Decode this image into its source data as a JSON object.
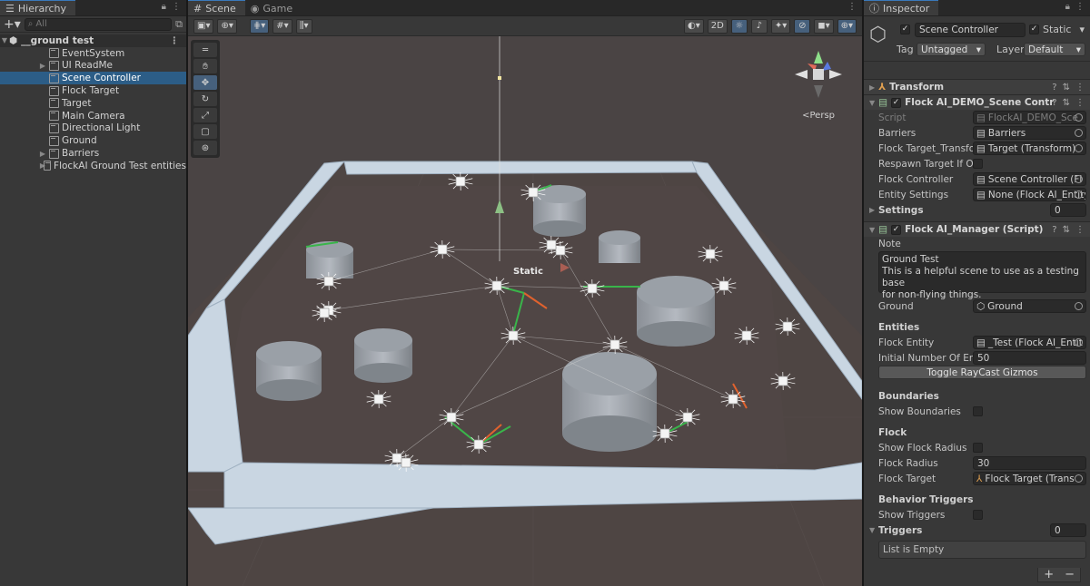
{
  "hierarchy": {
    "tab": "Hierarchy",
    "search_placeholder": "All",
    "scene": "__ground test",
    "items": [
      {
        "label": "EventSystem",
        "arrow": false,
        "selected": false
      },
      {
        "label": "UI ReadMe",
        "arrow": true,
        "selected": false
      },
      {
        "label": "Scene Controller",
        "arrow": false,
        "selected": true
      },
      {
        "label": "Flock Target",
        "arrow": false,
        "selected": false
      },
      {
        "label": "Target",
        "arrow": false,
        "selected": false
      },
      {
        "label": "Main Camera",
        "arrow": false,
        "selected": false
      },
      {
        "label": "Directional Light",
        "arrow": false,
        "selected": false
      },
      {
        "label": "Ground",
        "arrow": false,
        "selected": false
      },
      {
        "label": "Barriers",
        "arrow": true,
        "selected": false
      },
      {
        "label": "FlockAI Ground Test entities",
        "arrow": true,
        "selected": false
      }
    ]
  },
  "scene": {
    "tabs": [
      "Scene",
      "Game"
    ],
    "toolbar": {
      "mode_2d": "2D"
    },
    "persp_label": "<Persp",
    "static_label": "Static"
  },
  "inspector": {
    "tab": "Inspector",
    "object_name": "Scene Controller",
    "static_label": "Static",
    "tag_label": "Tag",
    "tag_value": "Untagged",
    "layer_label": "Layer",
    "layer_value": "Default",
    "transform": "Transform",
    "comp1": {
      "title": "Flock AI_DEMO_Scene Contr",
      "rows": [
        {
          "label": "Script",
          "value": "FlockAI_DEMO_Sce",
          "dim": true
        },
        {
          "label": "Barriers",
          "value": "Barriers",
          "dim": false
        },
        {
          "label": "Flock Target_Transfo",
          "value": "Target (Transform)",
          "dim": false
        },
        {
          "label": "Respawn Target If Ou",
          "value": "",
          "dim": false
        },
        {
          "label": "Flock Controller",
          "value": "Scene Controller (Fl",
          "dim": false
        },
        {
          "label": "Entity Settings",
          "value": "None (Flock AI_Entity_",
          "dim": false
        }
      ],
      "settings_label": "Settings",
      "settings_value": "0"
    },
    "comp2": {
      "title": "Flock AI_Manager (Script)",
      "note_label": "Note",
      "note_lines": [
        "Ground Test",
        "This is a helpful scene to use as a testing base",
        "for non-flying things."
      ],
      "ground_label": "Ground",
      "ground_value": "Ground",
      "entities_header": "Entities",
      "flock_entity_label": "Flock Entity",
      "flock_entity_value": "_Test (Flock AI_Entit",
      "initial_label": "Initial Number Of Entit",
      "initial_value": "50",
      "toggle_button": "Toggle RayCast Gizmos",
      "boundaries_header": "Boundaries",
      "show_boundaries": "Show Boundaries",
      "flock_header": "Flock",
      "show_flock_radius": "Show Flock Radius",
      "flock_radius_label": "Flock Radius",
      "flock_radius_value": "30",
      "flock_target_label": "Flock Target",
      "flock_target_value": "Flock Target (Trans",
      "behavior_header": "Behavior Triggers",
      "show_triggers": "Show Triggers",
      "triggers_label": "Triggers",
      "triggers_value": "0",
      "list_empty": "List is Empty"
    }
  }
}
